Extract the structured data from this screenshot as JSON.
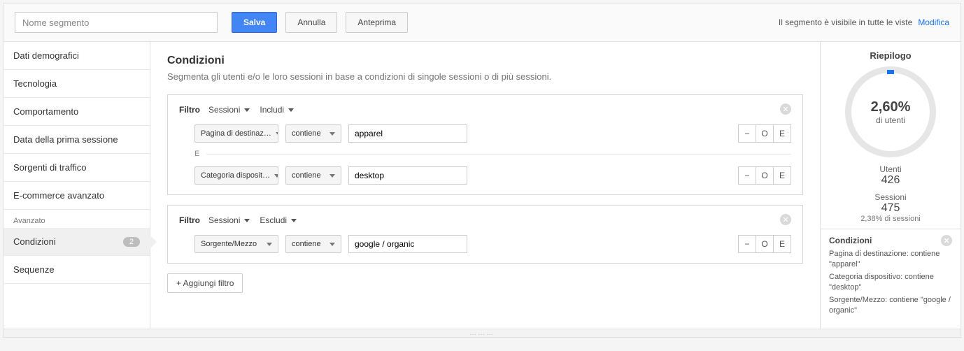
{
  "header": {
    "segment_placeholder": "Nome segmento",
    "save_label": "Salva",
    "cancel_label": "Annulla",
    "preview_label": "Anteprima",
    "visibility_text": "Il segmento è visibile in tutte le viste",
    "edit_label": "Modifica"
  },
  "sidebar": {
    "items": [
      {
        "label": "Dati demografici"
      },
      {
        "label": "Tecnologia"
      },
      {
        "label": "Comportamento"
      },
      {
        "label": "Data della prima sessione"
      },
      {
        "label": "Sorgenti di traffico"
      },
      {
        "label": "E-commerce avanzato"
      }
    ],
    "advanced_title": "Avanzato",
    "active": {
      "label": "Condizioni",
      "badge": "2"
    },
    "sequences": {
      "label": "Sequenze"
    }
  },
  "main": {
    "title": "Condizioni",
    "subtitle": "Segmenta gli utenti e/o le loro sessioni in base a condizioni di singole sessioni o di più sessioni.",
    "filter_label": "Filtro",
    "scope_sessions": "Sessioni",
    "include_label": "Includi",
    "exclude_label": "Escludi",
    "and_label": "E",
    "add_filter_label": "+ Aggiungi filtro",
    "op_minus": "−",
    "op_o": "O",
    "op_e": "E",
    "cards": [
      {
        "mode": "Includi",
        "rows": [
          {
            "dim": "Pagina di destinaz…",
            "match": "contiene",
            "value": "apparel"
          },
          {
            "dim": "Categoria disposit…",
            "match": "contiene",
            "value": "desktop"
          }
        ]
      },
      {
        "mode": "Escludi",
        "rows": [
          {
            "dim": "Sorgente/Mezzo",
            "match": "contiene",
            "value": "google / organic"
          }
        ]
      }
    ]
  },
  "summary": {
    "title": "Riepilogo",
    "pct": "2,60%",
    "pct_label": "di utenti",
    "users_label": "Utenti",
    "users_value": "426",
    "sessions_label": "Sessioni",
    "sessions_value": "475",
    "sessions_pct": "2,38% di sessioni",
    "cond_title": "Condizioni",
    "cond_lines": [
      "Pagina di destinazione: contiene \"apparel\"",
      "Categoria dispositivo: contiene \"desktop\"",
      "Sorgente/Mezzo: contiene \"google / organic\""
    ]
  }
}
